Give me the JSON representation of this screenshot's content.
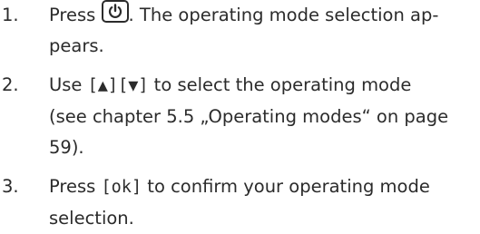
{
  "steps": [
    {
      "number": "1.",
      "press": "Press ",
      "power_icon": "power-icon",
      "line1_rest": ". The operating mode selection ap-",
      "line2": "pears."
    },
    {
      "number": "2.",
      "line1_use": "Use ",
      "key_up": "[▲]",
      "key_down": "[▼]",
      "line1_rest": " to select the operating mode",
      "line2": "(see chapter 5.5 „Operating modes“ on page",
      "line3": "59)."
    },
    {
      "number": "3.",
      "press": "Press ",
      "key_ok": "[ok]",
      "line1_rest": " to confirm your operating mode",
      "line2": "selection."
    }
  ]
}
